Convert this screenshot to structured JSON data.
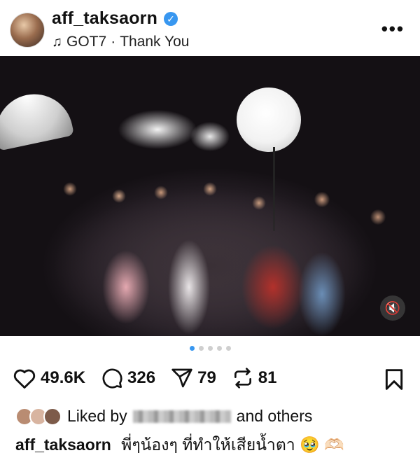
{
  "header": {
    "username": "aff_taksaorn",
    "music": {
      "artist": "GOT7",
      "separator": "·",
      "title": "Thank You"
    },
    "more_icon": "more-horizontal-icon"
  },
  "post": {
    "media_type": "photo",
    "carousel": {
      "count": 5,
      "active_index": 0
    },
    "mute_icon": "speaker-muted-icon"
  },
  "actions": {
    "likes": "49.6K",
    "comments": "326",
    "shares": "79",
    "reposts": "81"
  },
  "liked_by": {
    "prefix": "Liked by",
    "suffix": "and others"
  },
  "caption": {
    "username": "aff_taksaorn",
    "text": "พี่ๆน้องๆ ที่ทำให้เสียน้ำตา 🥹 🫶🏻"
  },
  "colors": {
    "verified": "#3897f0",
    "active_dot": "#3897f0"
  }
}
